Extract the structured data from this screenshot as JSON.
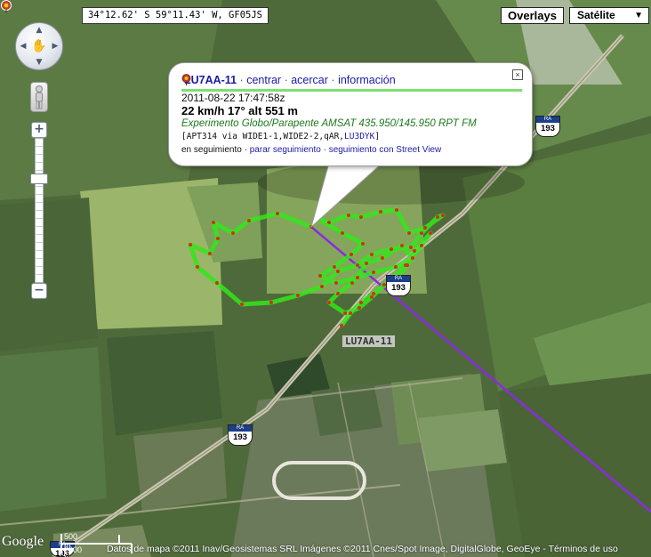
{
  "coordinates": "34°12.62' S 59°11.43' W, GF05JS",
  "controls": {
    "overlays_label": "Overlays",
    "map_type": "Satélite",
    "pan_up": "▲",
    "pan_down": "▼",
    "pan_left": "◀",
    "pan_right": "▶",
    "pan_hand": "✋",
    "zoom_in": "+",
    "zoom_out": "−",
    "select_arrow": "▼"
  },
  "infowindow": {
    "callsign": "LU7AA-11",
    "links": [
      "centrar",
      "acercar",
      "información"
    ],
    "separator": "·",
    "close": "×",
    "timestamp": "2011-08-22 17:47:58z",
    "speed_line": "22 km/h 17° alt 551 m",
    "comment": "Experimento Globo/Parapente AMSAT 435.950/145.950 RPT FM",
    "path_prefix": "[APT314 via WIDE1-1,WIDE2-2,qAR,",
    "path_igate": "LU3DYK",
    "path_suffix": "]",
    "follow_status": "en seguimiento",
    "follow_links": [
      "parar seguimiento",
      "seguimiento con Street View"
    ]
  },
  "station_label": "LU7AA-11",
  "route_shields": [
    {
      "prefix": "RA",
      "number": "193"
    },
    {
      "prefix": "RA",
      "number": "193"
    },
    {
      "prefix": "RA",
      "number": "193"
    },
    {
      "prefix": "RA",
      "number": "193"
    }
  ],
  "google_logo": "Google",
  "scale": {
    "metric": "500 m",
    "imperial": "2000 ft"
  },
  "attribution": "Datos de mapa ©2011 Inav/Geosistemas SRL Imágenes ©2011 Cnes/Spot Image, DigitalGlobe, GeoEye",
  "terms": "Términos de uso",
  "colors": {
    "track": "#33e61a",
    "track_point": "#d92b1a",
    "direction_line": "#8a2be2",
    "rule": "#7ee070",
    "link": "#1a1aa6"
  }
}
